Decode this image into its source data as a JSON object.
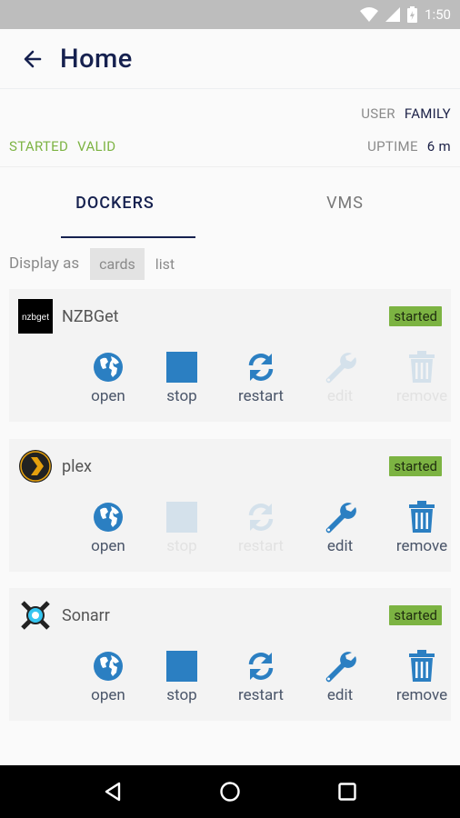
{
  "status_bar": {
    "time": "1:50"
  },
  "header": {
    "title": "Home"
  },
  "info": {
    "user_label": "USER",
    "user_value": "FAMILY",
    "state1": "STARTED",
    "state2": "VALID",
    "uptime_label": "UPTIME",
    "uptime_value": "6 m"
  },
  "tabs": [
    {
      "label": "DOCKERS"
    },
    {
      "label": "VMS"
    }
  ],
  "display": {
    "label": "Display as",
    "options": [
      "cards",
      "list"
    ],
    "selected": "cards"
  },
  "dockers": [
    {
      "name": "NZBGet",
      "status": "started",
      "logo_text": "nzbget",
      "actions": [
        {
          "label": "open",
          "icon": "globe-icon",
          "enabled": true
        },
        {
          "label": "stop",
          "icon": "stop-icon",
          "enabled": true
        },
        {
          "label": "restart",
          "icon": "restart-icon",
          "enabled": true
        },
        {
          "label": "edit",
          "icon": "wrench-icon",
          "enabled": false
        },
        {
          "label": "remove",
          "icon": "trash-icon",
          "enabled": false
        }
      ]
    },
    {
      "name": "plex",
      "status": "started",
      "actions": [
        {
          "label": "open",
          "icon": "globe-icon",
          "enabled": true
        },
        {
          "label": "stop",
          "icon": "stop-icon",
          "enabled": false
        },
        {
          "label": "restart",
          "icon": "restart-icon",
          "enabled": false
        },
        {
          "label": "edit",
          "icon": "wrench-icon",
          "enabled": true
        },
        {
          "label": "remove",
          "icon": "trash-icon",
          "enabled": true
        }
      ]
    },
    {
      "name": "Sonarr",
      "status": "started",
      "actions": [
        {
          "label": "open",
          "icon": "globe-icon",
          "enabled": true
        },
        {
          "label": "stop",
          "icon": "stop-icon",
          "enabled": true
        },
        {
          "label": "restart",
          "icon": "restart-icon",
          "enabled": true
        },
        {
          "label": "edit",
          "icon": "wrench-icon",
          "enabled": true
        },
        {
          "label": "remove",
          "icon": "trash-icon",
          "enabled": true
        }
      ]
    }
  ],
  "colors": {
    "accent": "#2b7fc2",
    "navy": "#16214f",
    "green": "#7cb342"
  }
}
